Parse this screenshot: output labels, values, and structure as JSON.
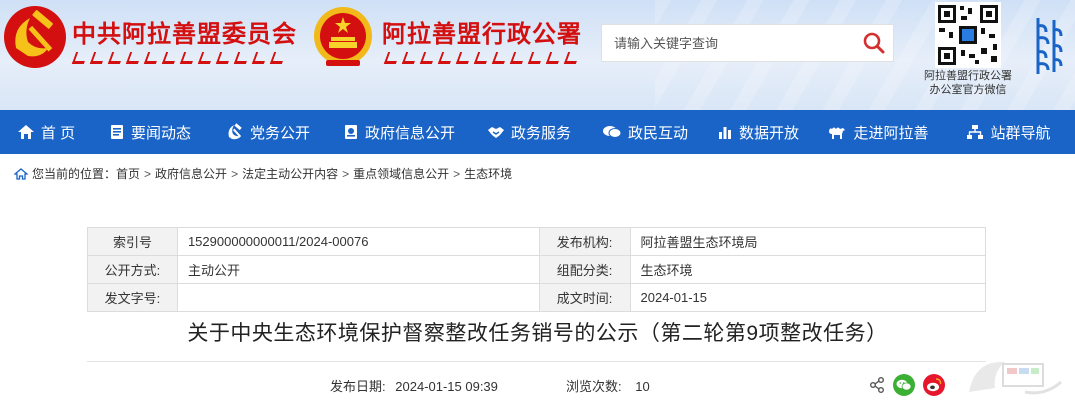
{
  "header": {
    "party_title": "中共阿拉善盟委员会",
    "gov_title": "阿拉善盟行政公署",
    "search_placeholder": "请输入关键字查询",
    "qr_caption_line1": "阿拉善盟行政公署",
    "qr_caption_line2": "办公室官方微信"
  },
  "nav": {
    "items": [
      {
        "label": "首 页",
        "icon": "home-icon"
      },
      {
        "label": "要闻动态",
        "icon": "news-icon"
      },
      {
        "label": "党务公开",
        "icon": "party-icon"
      },
      {
        "label": "政府信息公开",
        "icon": "document-icon"
      },
      {
        "label": "政务服务",
        "icon": "handshake-icon"
      },
      {
        "label": "政民互动",
        "icon": "chat-icon"
      },
      {
        "label": "数据开放",
        "icon": "bar-chart-icon"
      },
      {
        "label": "走进阿拉善",
        "icon": "camel-icon"
      },
      {
        "label": "站群导航",
        "icon": "sitemap-icon"
      }
    ]
  },
  "breadcrumb": {
    "prefix": "您当前的位置：",
    "items": [
      "首页",
      "政府信息公开",
      "法定主动公开内容",
      "重点领域信息公开",
      "生态环境"
    ]
  },
  "info": {
    "index_label": "索引号",
    "index_value": "152900000000011/2024-00076",
    "publisher_label": "发布机构:",
    "publisher_value": "阿拉善盟生态环境局",
    "disclosure_label": "公开方式:",
    "disclosure_value": "主动公开",
    "category_label": "组配分类:",
    "category_value": "生态环境",
    "docno_label": "发文字号:",
    "docno_value": "",
    "date_label": "成文时间:",
    "date_value": "2024-01-15"
  },
  "article": {
    "title": "关于中央生态环境保护督察整改任务销号的公示（第二轮第9项整改任务）",
    "publish_label": "发布日期:",
    "publish_value": "2024-01-15 09:39",
    "views_label": "浏览次数:",
    "views_value": "10"
  },
  "colors": {
    "nav_bg": "#1a64c8",
    "title_red": "#d40f0f",
    "wechat_green": "#3cb034",
    "weibo_red": "#e6162d"
  }
}
